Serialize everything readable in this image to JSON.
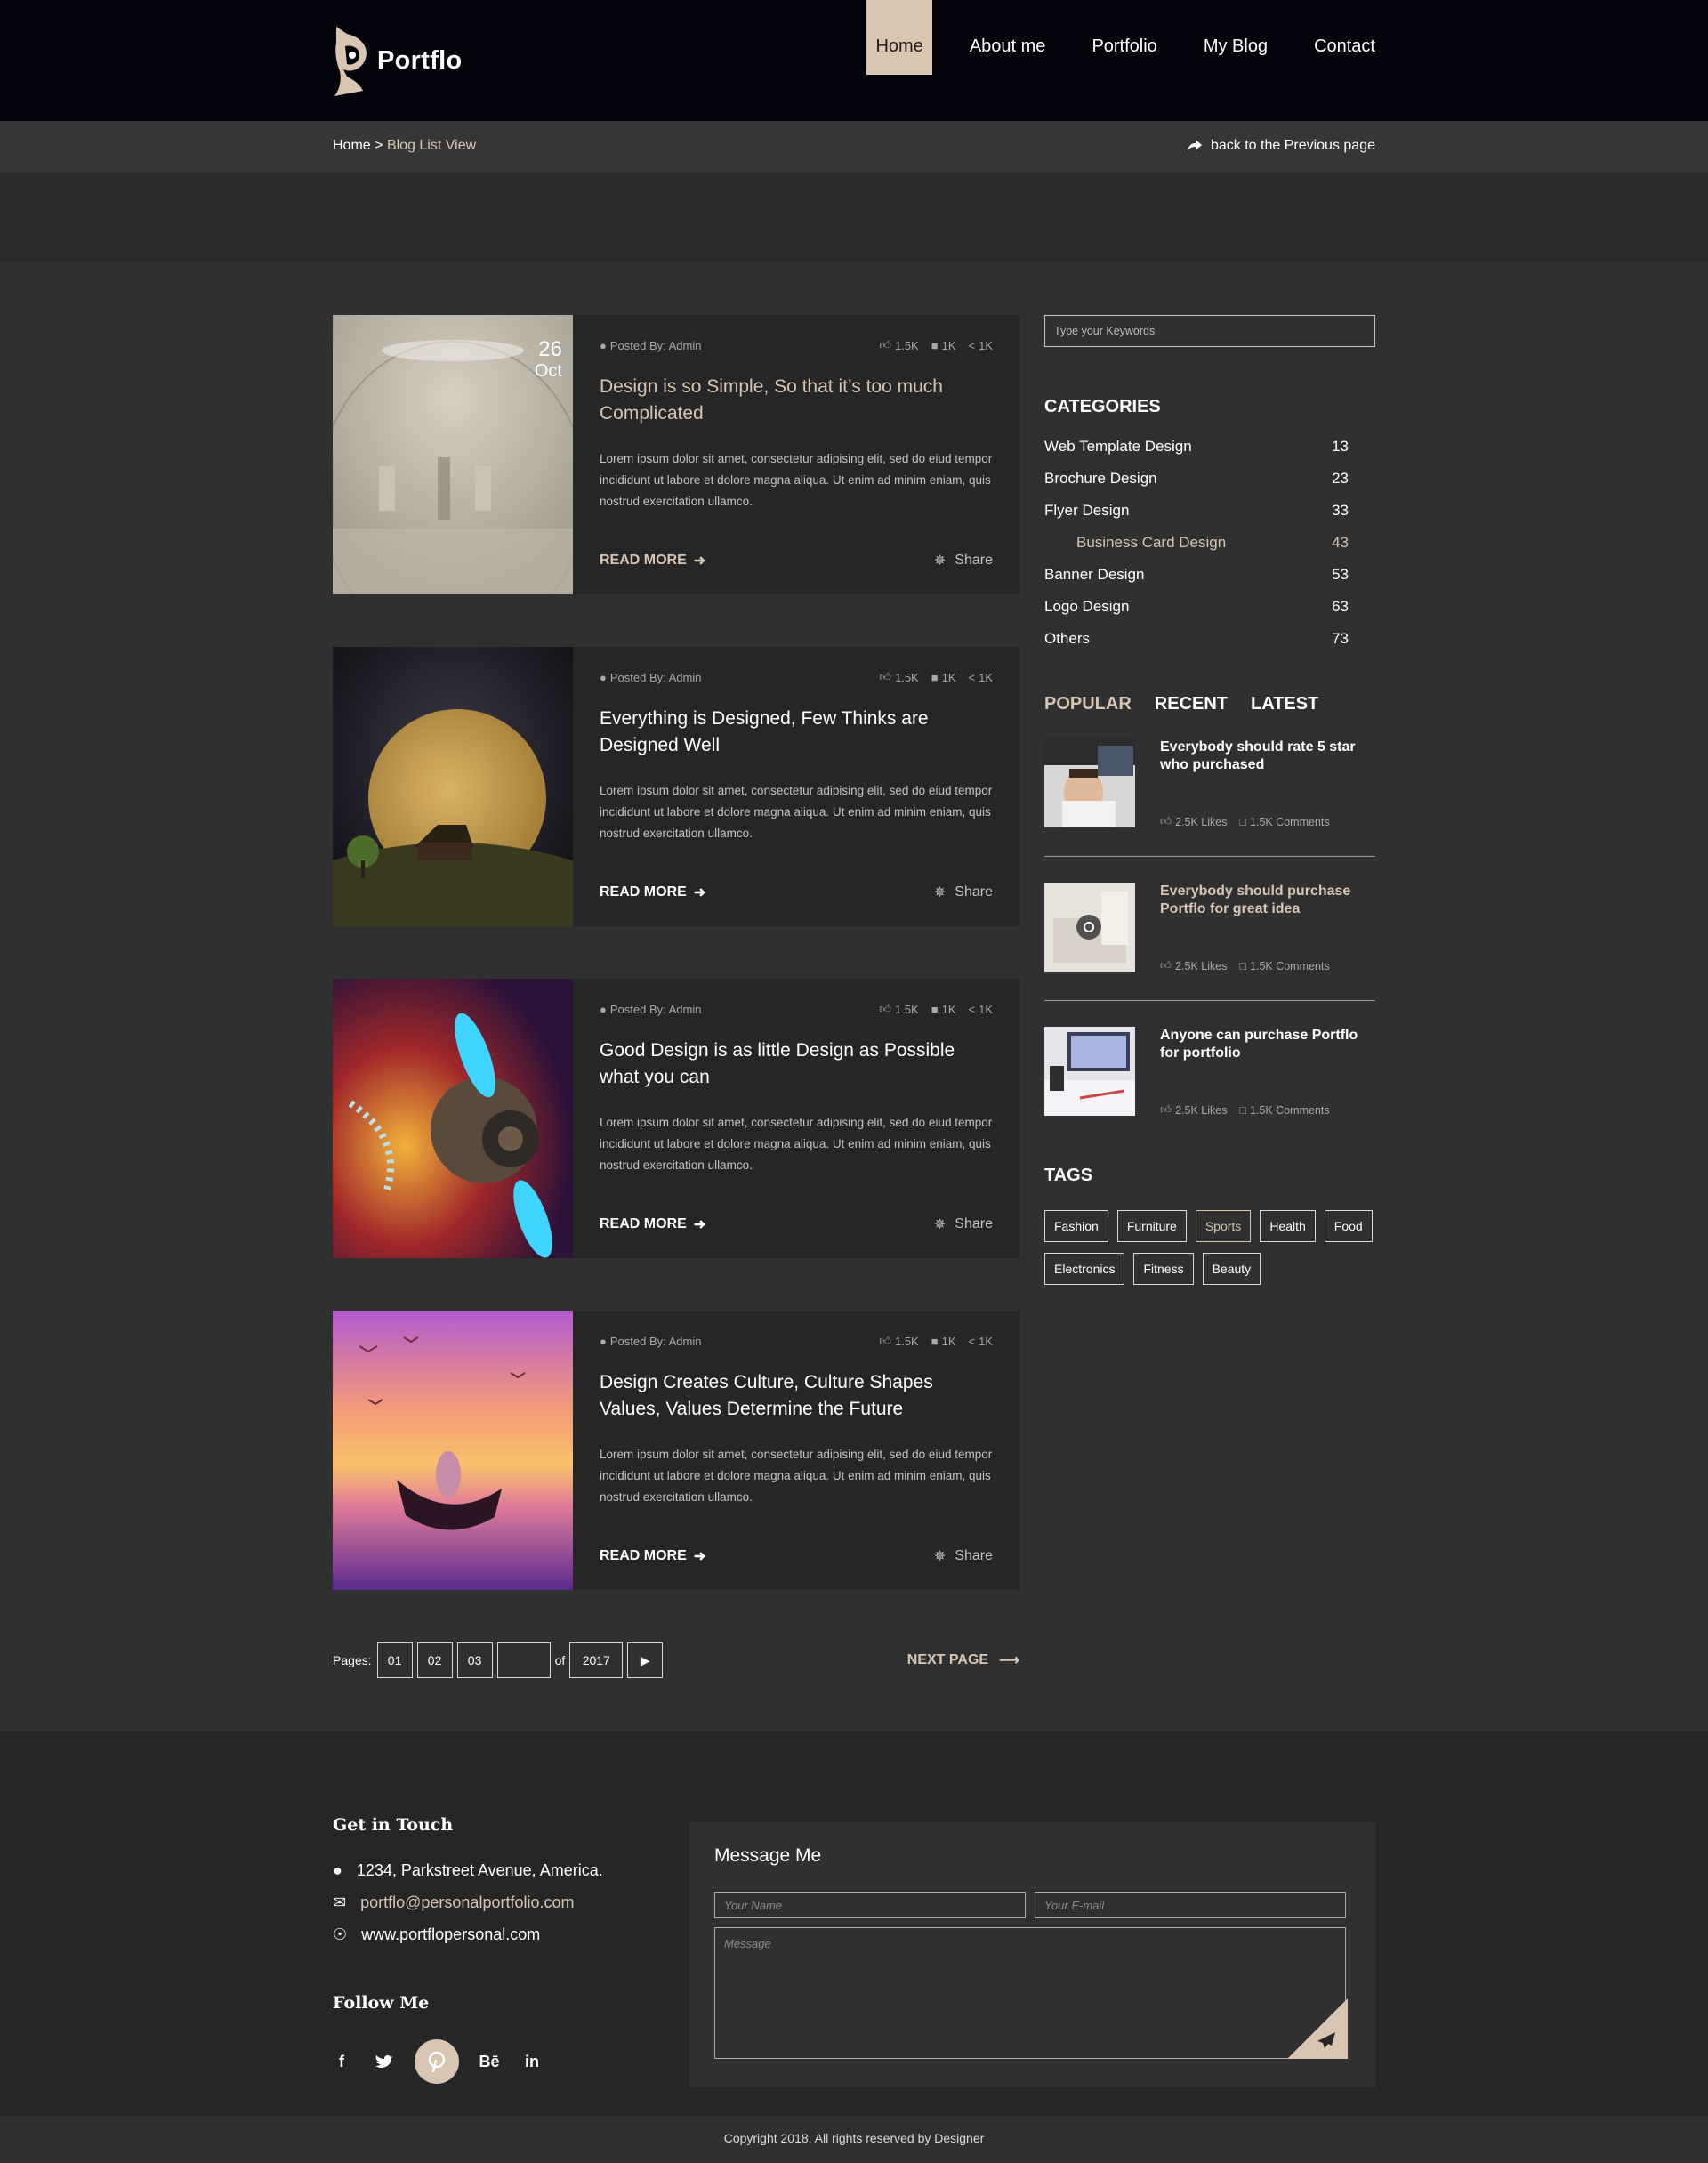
{
  "brand": {
    "name": "Portflo",
    "accent": "#d8c5b2",
    "background": "#303031",
    "header_bg": "#03030b"
  },
  "nav": [
    {
      "label": "Home",
      "active": true
    },
    {
      "label": "About me"
    },
    {
      "label": "Portfolio"
    },
    {
      "label": "My Blog"
    },
    {
      "label": "Contact"
    }
  ],
  "breadcrumb": {
    "home": "Home",
    "separator": ">",
    "current": "Blog List View",
    "back": "back to the Previous page"
  },
  "posts": [
    {
      "date_day": "26",
      "date_month": "Oct",
      "author": "Posted By: Admin",
      "likes": "1.5K",
      "comments": "1K",
      "shares": "1K",
      "title": "Design is so Simple, So that it’s too much Complicated",
      "excerpt": "Lorem ipsum dolor sit amet, consectetur adipising elit, sed do eiud tempor incididunt ut labore et dolore magna aliqua. Ut enim ad minim eniam, quis nostrud exercitation ullamco.",
      "read_more": "READ MORE",
      "share": "Share"
    },
    {
      "author": "Posted By: Admin",
      "likes": "1.5K",
      "comments": "1K",
      "shares": "1K",
      "title": "Everything is Designed, Few Thinks are Designed Well",
      "excerpt": "Lorem ipsum dolor sit amet, consectetur adipising elit, sed do eiud tempor incididunt ut labore et dolore magna aliqua. Ut enim ad minim eniam, quis nostrud exercitation ullamco.",
      "read_more": "READ MORE",
      "share": "Share"
    },
    {
      "author": "Posted By: Admin",
      "likes": "1.5K",
      "comments": "1K",
      "shares": "1K",
      "title": "Good Design is as little Design as Possible what you can",
      "excerpt": "Lorem ipsum dolor sit amet, consectetur adipising elit, sed do eiud tempor incididunt ut labore et dolore magna aliqua. Ut enim ad minim eniam, quis nostrud exercitation ullamco.",
      "read_more": "READ MORE",
      "share": "Share"
    },
    {
      "author": "Posted By: Admin",
      "likes": "1.5K",
      "comments": "1K",
      "shares": "1K",
      "title": "Design Creates Culture, Culture Shapes Values, Values Determine the Future",
      "excerpt": "Lorem ipsum dolor sit amet, consectetur adipising elit, sed do eiud tempor incididunt ut labore et dolore magna aliqua. Ut enim ad minim eniam, quis nostrud exercitation ullamco.",
      "read_more": "READ MORE",
      "share": "Share"
    }
  ],
  "pagination": {
    "label": "Pages:",
    "pages": [
      "01",
      "02",
      "03"
    ],
    "current_input": "",
    "of": "of",
    "total": "2017",
    "next": "NEXT PAGE"
  },
  "sidebar": {
    "search_placeholder": "Type your Keywords",
    "categories_title": "CATEGORIES",
    "categories": [
      {
        "name": "Web Template Design",
        "count": "13"
      },
      {
        "name": "Brochure Design",
        "count": "23"
      },
      {
        "name": "Flyer Design",
        "count": "33"
      },
      {
        "name": "Business Card Design",
        "count": "43"
      },
      {
        "name": "Banner Design",
        "count": "53"
      },
      {
        "name": "Logo Design",
        "count": "63"
      },
      {
        "name": "Others",
        "count": "73"
      }
    ],
    "tabs": [
      "POPULAR",
      "RECENT",
      "LATEST"
    ],
    "popular": [
      {
        "title": "Everybody should rate 5 star who purchased",
        "likes": "2.5K Likes",
        "comments": "1.5K Comments"
      },
      {
        "title": "Everybody should purchase Portflo for great idea",
        "likes": "2.5K Likes",
        "comments": "1.5K Comments"
      },
      {
        "title": "Anyone can purchase Portflo for portfolio",
        "likes": "2.5K Likes",
        "comments": "1.5K Comments"
      }
    ],
    "tags_title": "TAGS",
    "tags": [
      "Fashion",
      "Furniture",
      "Sports",
      "Health",
      "Food",
      "Electronics",
      "Fitness",
      "Beauty"
    ]
  },
  "footer": {
    "get_in_touch": "Get in Touch",
    "address": "1234, Parkstreet Avenue, America.",
    "email": "portflo@personalportfolio.com",
    "website": "www.portflopersonal.com",
    "follow_me": "Follow Me",
    "social": [
      "f",
      "twitter",
      "pinterest",
      "Bē",
      "in"
    ],
    "message_title": "Message Me",
    "name_placeholder": "Your Name",
    "email_placeholder": "Your E-mail",
    "message_placeholder": "Message",
    "copyright": "Copyright 2018. All rights reserved by Designer"
  }
}
